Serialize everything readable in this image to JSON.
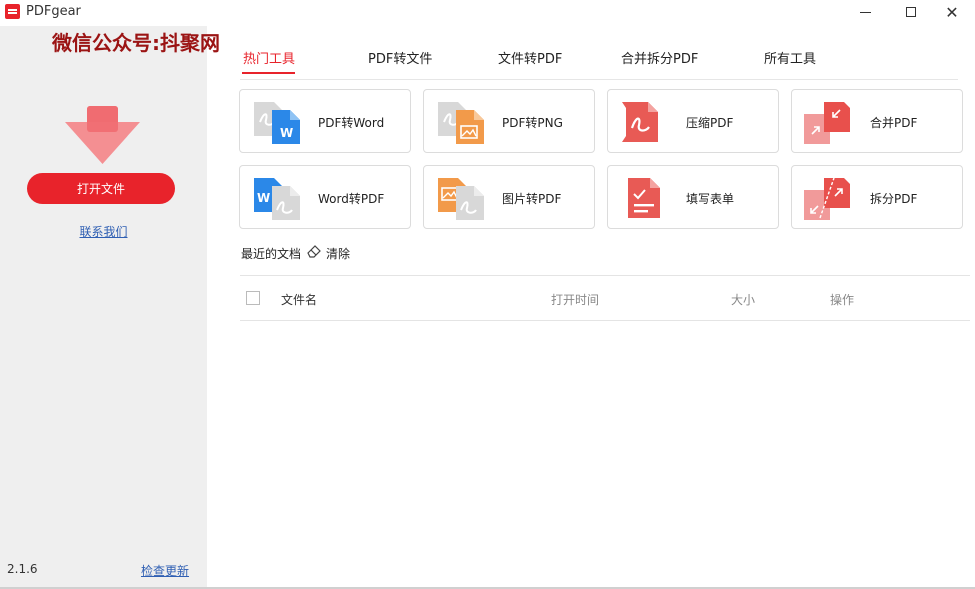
{
  "window": {
    "title": "PDFgear",
    "minimize_glyph": "—",
    "maximize_glyph": "☐",
    "close_glyph": "✕"
  },
  "watermark": "微信公众号:抖聚网",
  "sidebar": {
    "open_button": "打开文件",
    "contact": "联系我们",
    "version": "2.1.6",
    "check_update": "检查更新"
  },
  "tabs": [
    {
      "label": "热门工具",
      "active": true
    },
    {
      "label": "PDF转文件"
    },
    {
      "label": "文件转PDF"
    },
    {
      "label": "合并拆分PDF"
    },
    {
      "label": "所有工具"
    }
  ],
  "tools": [
    {
      "label": "PDF转Word",
      "icon": "pdf-to-word-icon"
    },
    {
      "label": "PDF转PNG",
      "icon": "pdf-to-png-icon"
    },
    {
      "label": "压缩PDF",
      "icon": "compress-pdf-icon"
    },
    {
      "label": "合并PDF",
      "icon": "merge-pdf-icon"
    },
    {
      "label": "Word转PDF",
      "icon": "word-to-pdf-icon"
    },
    {
      "label": "图片转PDF",
      "icon": "image-to-pdf-icon"
    },
    {
      "label": "填写表单",
      "icon": "fill-form-icon"
    },
    {
      "label": "拆分PDF",
      "icon": "split-pdf-icon"
    }
  ],
  "recent": {
    "title": "最近的文档",
    "clear": "清除",
    "columns": [
      "文件名",
      "打开时间",
      "大小",
      "操作"
    ]
  },
  "colors": {
    "accent": "#e8232b",
    "link": "#2f5fb3",
    "sidebar_bg": "#efefef"
  }
}
